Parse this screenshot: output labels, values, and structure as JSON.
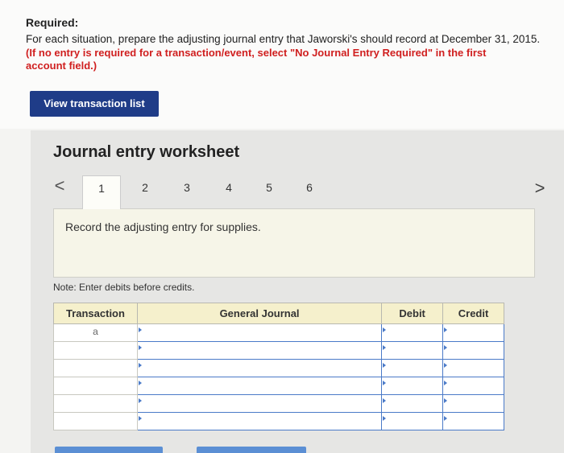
{
  "instructions": {
    "title": "Required:",
    "text": "For each situation, prepare the adjusting journal entry that Jaworski's should record at December 31, 2015.",
    "note": "(If no entry is required for a transaction/event, select \"No Journal Entry Required\" in the first account field.)"
  },
  "view_button_label": "View transaction list",
  "worksheet": {
    "title": "Journal entry worksheet",
    "prev_glyph": "<",
    "next_glyph": ">",
    "tabs": [
      "1",
      "2",
      "3",
      "4",
      "5",
      "6"
    ],
    "active_tab": "1",
    "prompt": "Record the adjusting entry for supplies.",
    "note": "Note: Enter debits before credits."
  },
  "journal": {
    "headers": [
      "Transaction",
      "General Journal",
      "Debit",
      "Credit"
    ],
    "rows": [
      {
        "transaction": "a",
        "account": "",
        "debit": "",
        "credit": ""
      },
      {
        "transaction": "",
        "account": "",
        "debit": "",
        "credit": ""
      },
      {
        "transaction": "",
        "account": "",
        "debit": "",
        "credit": ""
      },
      {
        "transaction": "",
        "account": "",
        "debit": "",
        "credit": ""
      },
      {
        "transaction": "",
        "account": "",
        "debit": "",
        "credit": ""
      },
      {
        "transaction": "",
        "account": "",
        "debit": "",
        "credit": ""
      }
    ]
  },
  "colors": {
    "accent": "#1f3c88",
    "warning": "#d01f1f",
    "header_bg": "#f5f0cc",
    "input_border": "#4a7ac8"
  }
}
